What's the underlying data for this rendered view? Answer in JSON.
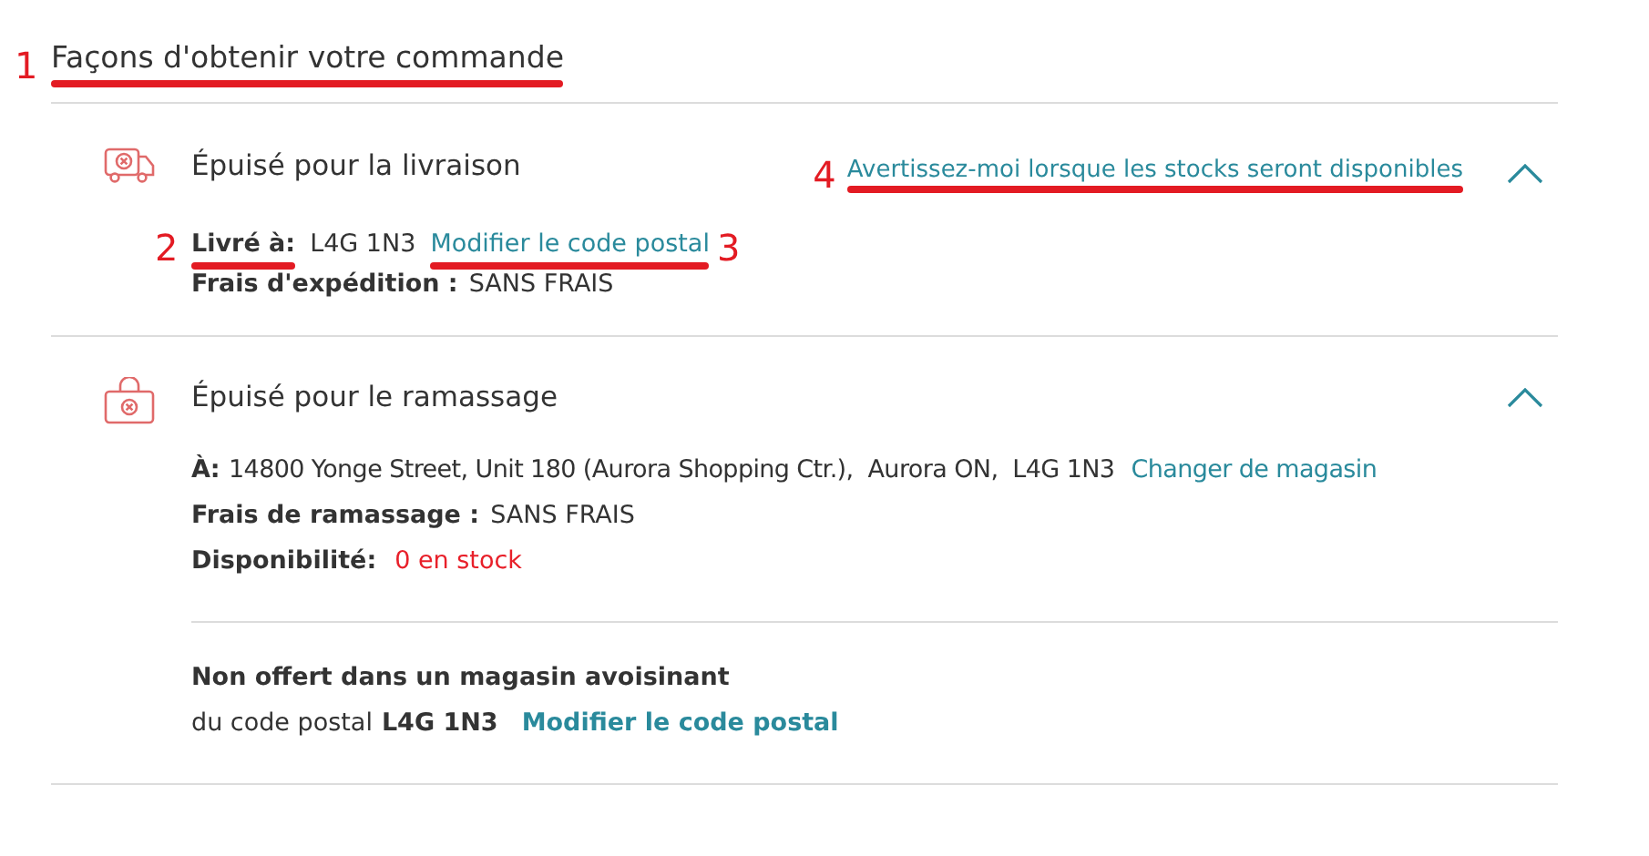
{
  "heading": {
    "text": "Façons d'obtenir votre commande",
    "marker": "1"
  },
  "delivery": {
    "title": "Épuisé pour la livraison",
    "expanded": true,
    "notify_link": {
      "text": "Avertissez-moi lorsque les stocks seront disponibles",
      "marker": "4"
    },
    "ship_to": {
      "label": "Livré à:",
      "label_marker": "2",
      "value": "L4G 1N3",
      "link": "Modifier le code postal",
      "link_marker": "3"
    },
    "fee": {
      "label": "Frais d'expédition :",
      "value": "SANS FRAIS"
    }
  },
  "pickup": {
    "title": "Épuisé pour le ramassage",
    "expanded": true,
    "store": {
      "label": "À:",
      "value": "14800 Yonge Street, Unit 180 (Aurora Shopping Ctr.),  Aurora ON,  L4G 1N3",
      "link": "Changer de magasin"
    },
    "fee": {
      "label": "Frais de ramassage :",
      "value": "SANS FRAIS"
    },
    "availability": {
      "label": "Disponibilité:",
      "value": "0 en stock"
    },
    "nearby": {
      "title": "Non offert dans un magasin avoisinant",
      "prefix": "du code postal",
      "postal": "L4G 1N3",
      "link": "Modifier le code postal"
    }
  }
}
